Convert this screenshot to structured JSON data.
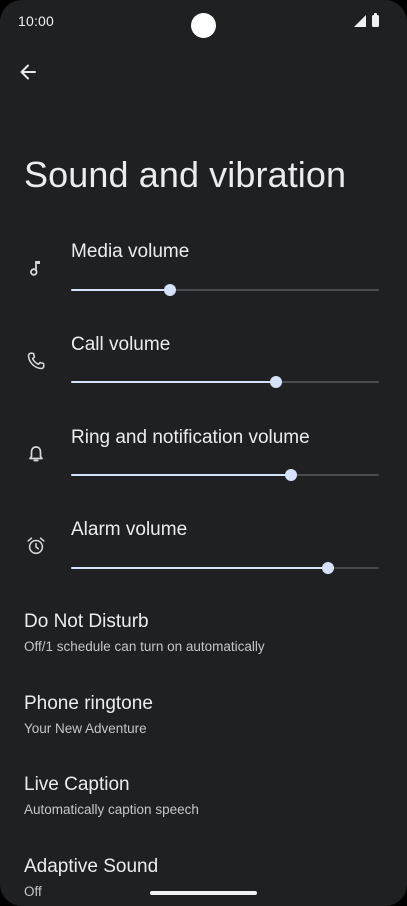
{
  "status_bar": {
    "time": "10:00"
  },
  "page": {
    "title": "Sound and vibration"
  },
  "volumes": [
    {
      "label": "Media volume",
      "icon": "music-note-icon",
      "level": 0.32
    },
    {
      "label": "Call volume",
      "icon": "phone-icon",
      "level": 0.665
    },
    {
      "label": "Ring and notification volume",
      "icon": "bell-icon",
      "level": 0.715
    },
    {
      "label": "Alarm volume",
      "icon": "alarm-clock-icon",
      "level": 0.835
    }
  ],
  "items": [
    {
      "title": "Do Not Disturb",
      "subtitle": "Off/1 schedule can turn on automatically"
    },
    {
      "title": "Phone ringtone",
      "subtitle": "Your New Adventure"
    },
    {
      "title": "Live Caption",
      "subtitle": "Automatically caption speech"
    },
    {
      "title": "Adaptive Sound",
      "subtitle": "Off"
    }
  ],
  "colors": {
    "background": "#1f2022",
    "accent": "#d5e2fb",
    "track": "#4a4b50"
  }
}
